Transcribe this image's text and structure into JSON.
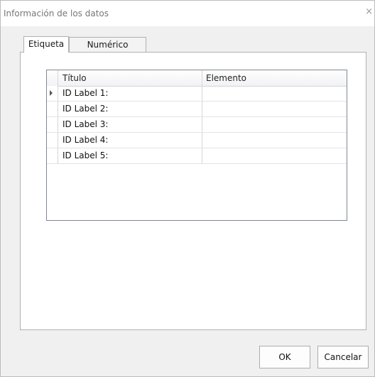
{
  "window": {
    "title": "Información de los datos",
    "close_symbol": "×"
  },
  "tabs": [
    {
      "label": "Etiqueta",
      "active": true
    },
    {
      "label": "Numérico",
      "active": false
    }
  ],
  "grid": {
    "columns": [
      "Título",
      "Elemento"
    ],
    "rows": [
      {
        "title": "ID Label 1:",
        "element": "",
        "current": true
      },
      {
        "title": "ID Label 2:",
        "element": "",
        "current": false
      },
      {
        "title": "ID Label 3:",
        "element": "",
        "current": false
      },
      {
        "title": "ID Label 4:",
        "element": "",
        "current": false
      },
      {
        "title": "ID Label 5:",
        "element": "",
        "current": false
      }
    ]
  },
  "buttons": {
    "ok_label": "OK",
    "cancel_label": "Cancelar"
  },
  "icons": {
    "close": "close-icon",
    "current_row": "current-row-arrow-icon"
  }
}
